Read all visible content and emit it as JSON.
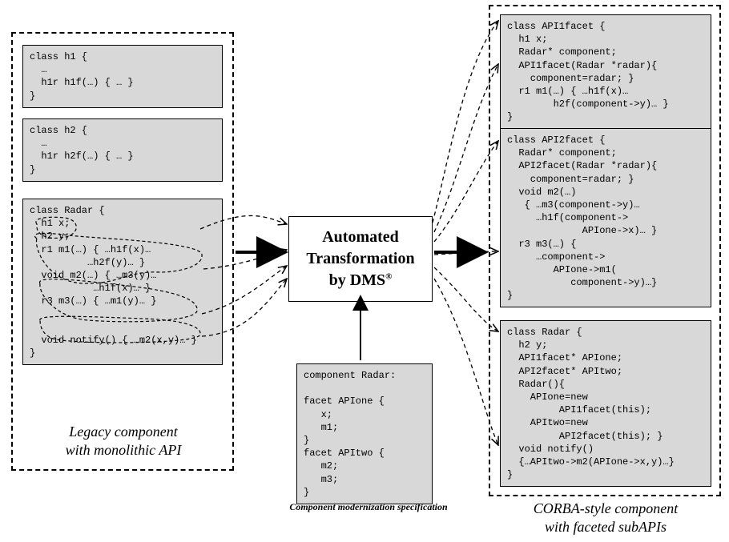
{
  "left": {
    "title": "Legacy component\nwith monolithic API",
    "h1_code": "class h1 {\n  …\n  h1r h1f(…) { … }\n}",
    "h2_code": "class h2 {\n  …\n  h1r h2f(…) { … }\n}",
    "radar_code": "class Radar {\n  h1 x;\n  h2 y;\n  r1 m1(…) { …h1f(x)…\n          …h2f(y)… }\n  void m2(…) { …m3(y)…\n           …h1f(x)… }\n  r3 m3(…) { …m1(y)… }\n\n\n  void notify() { …m2(x,y)… }\n}"
  },
  "center": {
    "title_l1": "Automated",
    "title_l2": "Transformation",
    "title_l3": "by DMS",
    "reg": "®",
    "spec_code": "component Radar:\n\nfacet APIone {\n   x;\n   m1;\n}\nfacet APItwo {\n   m2;\n   m3;\n}",
    "spec_caption": "Component modernization specification"
  },
  "right": {
    "title": "CORBA-style component\nwith faceted subAPIs",
    "api1_code": "class API1facet {\n  h1 x;\n  Radar* component;\n  API1facet(Radar *radar){\n    component=radar; }\n  r1 m1(…) { …h1f(x)…\n        h2f(component->y)… }\n}",
    "api2_code": "class API2facet {\n  Radar* component;\n  API2facet(Radar *radar){\n    component=radar; }\n  void m2(…)\n   { …m3(component->y)…\n     …h1f(component->\n             APIone->x)… }\n  r3 m3(…) {\n     …component->\n        APIone->m1(\n           component->y)…}\n}",
    "radar_code": "class Radar {\n  h2 y;\n  API1facet* APIone;\n  API2facet* APItwo;\n  Radar(){\n    APIone=new\n         API1facet(this);\n    APItwo=new\n         API2facet(this); }\n  void notify()\n  {…APItwo->m2(APIone->x,y)…}\n}"
  }
}
